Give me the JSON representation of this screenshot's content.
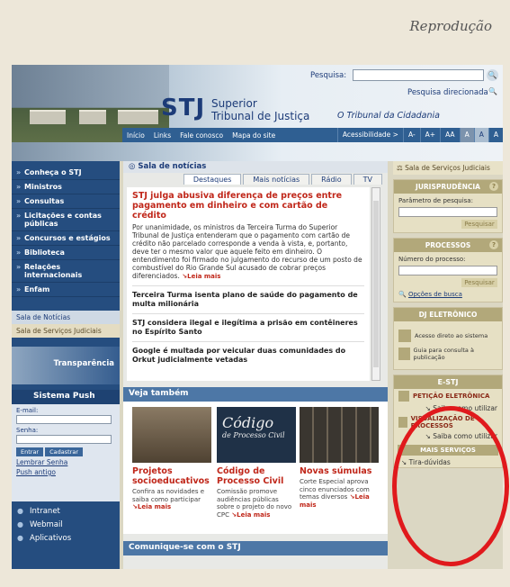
{
  "caption": "Reprodução",
  "header": {
    "search_label": "Pesquisa:",
    "directed_search": "Pesquisa direcionada",
    "logo": "STJ",
    "logo_sub1": "Superior",
    "logo_sub2": "Tribunal de Justiça",
    "motto": "O Tribunal da Cidadania",
    "topnav": [
      "Início",
      "Links",
      "Fale conosco",
      "Mapa do site"
    ],
    "accessibility": "Acessibilidade >",
    "font_buttons": [
      "A-",
      "A+",
      "AA",
      "A",
      "A",
      "A"
    ]
  },
  "left": {
    "nav": [
      "Conheça o STJ",
      "Ministros",
      "Consultas",
      "Licitações e contas públicas",
      "Concursos e estágios",
      "Biblioteca",
      "Relações internacionais",
      "Enfam"
    ],
    "sala": "Sala de Notícias",
    "servicos": "Sala de Serviços Judiciais",
    "transparencia": "Transparência",
    "push_title": "Sistema Push",
    "email_label": "E-mail:",
    "senha_label": "Senha:",
    "entrar": "Entrar",
    "cadastrar": "Cadastrar",
    "lembrar": "Lembrar Senha",
    "push_antigo": "Push antigo",
    "bottom": [
      "Intranet",
      "Webmail",
      "Aplicativos"
    ]
  },
  "main": {
    "noticias_title": "Sala de notícias",
    "tabs": [
      "Destaques",
      "Mais notícias",
      "Rádio",
      "TV"
    ],
    "headline": "STJ julga abusiva diferença de preços entre pagamento em dinheiro e com cartão de crédito",
    "body": "Por unanimidade, os ministros da Terceira Turma do Superior Tribunal de Justiça entenderam que o pagamento com cartão de crédito não parcelado corresponde a venda à vista, e, portanto, deve ter o mesmo valor que aquele feito em dinheiro. O entendimento foi firmado no julgamento do recurso de um posto de combustível do Rio Grande Sul acusado de cobrar preços diferenciados.",
    "leia": "Leia mais",
    "items": [
      "Terceira Turma isenta plano de saúde do pagamento de multa milionária",
      "STJ considera ilegal e ilegítima a prisão em contêineres no Espírito Santo",
      "Google é multada por veicular duas comunidades do Orkut judicialmente vetadas"
    ],
    "veja": "Veja também",
    "cards": [
      {
        "title": "Projetos socioeducativos",
        "desc": "Confira as novidades e saiba como participar",
        "leia": "Leia mais"
      },
      {
        "title": "Código de Processo Civil",
        "desc": "Comissão promove audiências públicas sobre o projeto do novo CPC",
        "leia": "Leia mais"
      },
      {
        "title": "Novas súmulas",
        "desc": "Corte Especial aprova cinco enunciados com temas diversos",
        "leia": "Leia mais"
      }
    ],
    "cover_text1": "Código",
    "cover_text2": "de Processo Civil",
    "comunique": "Comunique-se com o STJ"
  },
  "right": {
    "sala": "Sala de Serviços Judiciais",
    "juris": "JURISPRUDÊNCIA",
    "param": "Parâmetro de pesquisa:",
    "pesquisar": "Pesquisar",
    "processos": "PROCESSOS",
    "numero": "Número do processo:",
    "opcoes": "Opções de busca",
    "dj": "DJ ELETRÔNICO",
    "dj_items": [
      "Acesso direto ao sistema",
      "Guia para consulta à publicação"
    ],
    "estj": "E-STJ",
    "peticao": "PETIÇÃO ELETRÔNICA",
    "saiba": "Saiba como utilizar",
    "visual": "VISUALIZAÇÃO DE PROCESSOS",
    "mais": "MAIS SERVIÇOS",
    "tira": "Tira-dúvidas"
  },
  "colors": {
    "accent": "#c0271a",
    "nav": "#254d7f",
    "highlight_oval": "#e0191c"
  }
}
